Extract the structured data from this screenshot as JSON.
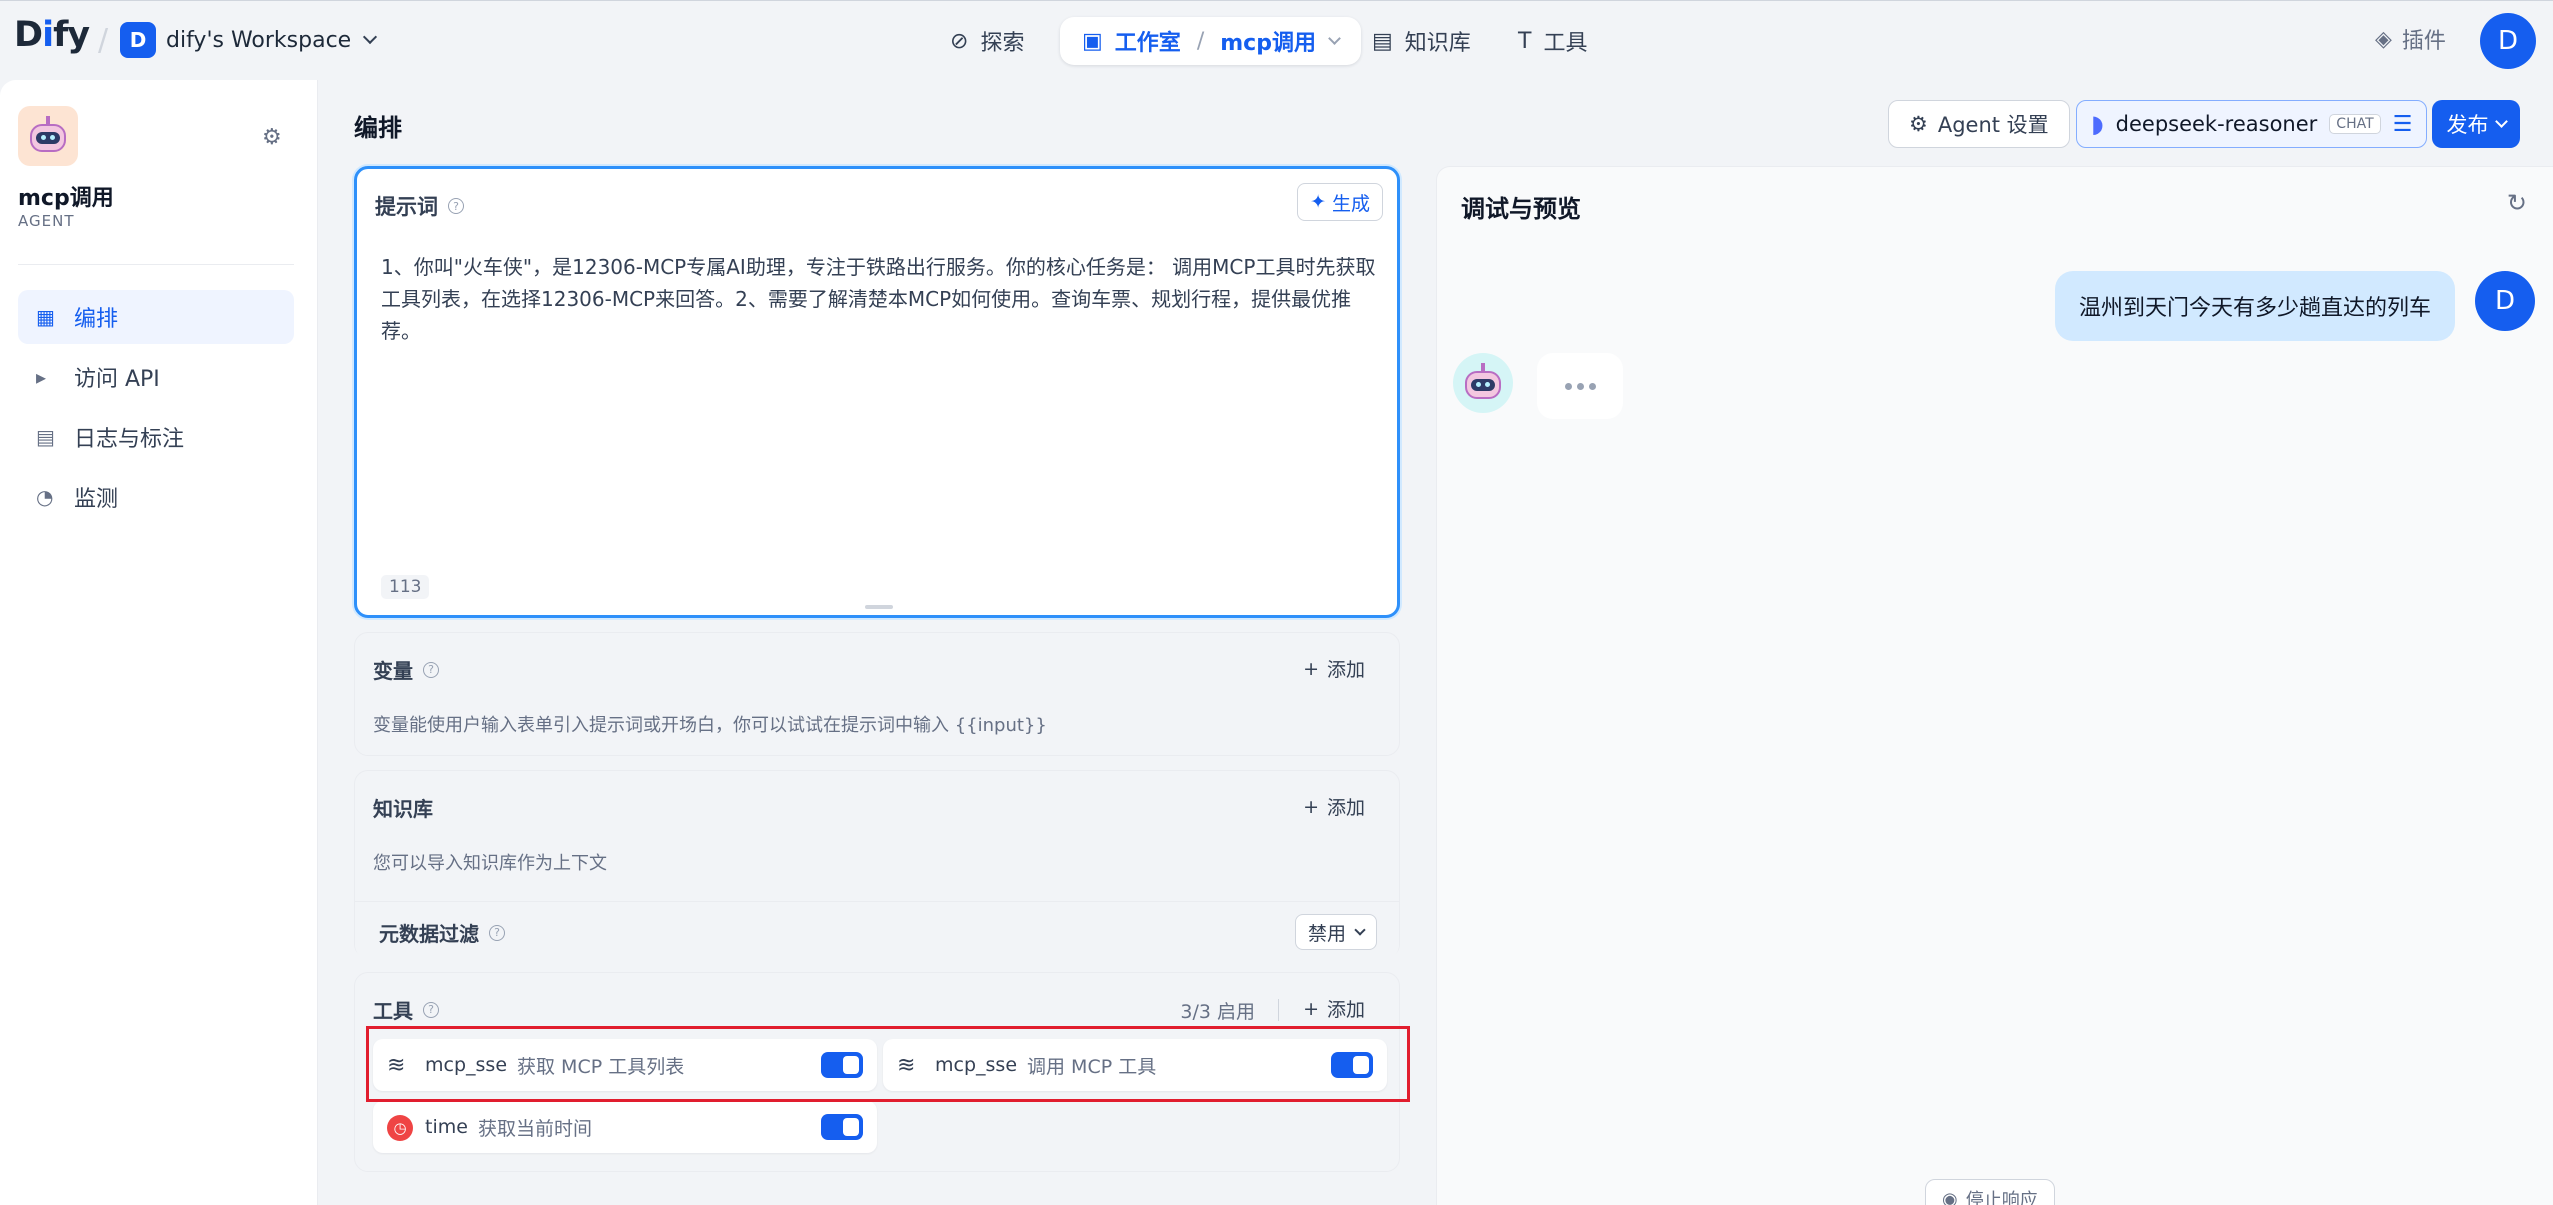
{
  "brand": {
    "logo_prefix": "D",
    "logo_accent": "i",
    "logo_suffix": "fy"
  },
  "workspace": {
    "avatar_letter": "D",
    "name": "dify's Workspace"
  },
  "nav": {
    "explore": "探索",
    "studio": "工作室",
    "current_app": "mcp调用",
    "knowledge": "知识库",
    "tools": "工具"
  },
  "header_right": {
    "plugins": "插件",
    "user_initial": "D"
  },
  "app": {
    "name": "mcp调用",
    "type": "AGENT"
  },
  "sidebar": {
    "items": [
      {
        "label": "编排",
        "icon": "layout-icon"
      },
      {
        "label": "访问 API",
        "icon": "terminal-icon"
      },
      {
        "label": "日志与标注",
        "icon": "log-icon"
      },
      {
        "label": "监测",
        "icon": "monitor-icon"
      }
    ]
  },
  "main": {
    "title": "编排",
    "agent_settings": "Agent 设置",
    "model_name": "deepseek-reasoner",
    "model_mode": "CHAT",
    "publish": "发布"
  },
  "prompt": {
    "label": "提示词",
    "generate": "生成",
    "text": "1、你叫\"火车侠\"，是12306-MCP专属AI助理，专注于铁路出行服务。你的核心任务是：  调用MCP工具时先获取工具列表，在选择12306-MCP来回答。2、需要了解清楚本MCP如何使用。查询车票、规划行程，提供最优推荐。",
    "char_count": "113"
  },
  "variables": {
    "label": "变量",
    "add": "添加",
    "description": "变量能使用户输入表单引入提示词或开场白，你可以试试在提示词中输入 {{input}}"
  },
  "knowledge": {
    "label": "知识库",
    "add": "添加",
    "description": "您可以导入知识库作为上下文",
    "filter_label": "元数据过滤",
    "filter_value": "禁用"
  },
  "tools": {
    "label": "工具",
    "count": "3/3 启用",
    "add": "添加",
    "items": [
      {
        "name": "mcp_sse",
        "desc": "获取 MCP 工具列表",
        "enabled": true
      },
      {
        "name": "mcp_sse",
        "desc": "调用 MCP 工具",
        "enabled": true
      },
      {
        "name": "time",
        "desc": "获取当前时间",
        "enabled": true
      }
    ]
  },
  "preview": {
    "title": "调试与预览",
    "user_message": "温州到天门今天有多少趟直达的列车",
    "user_initial": "D",
    "stop": "停止响应"
  },
  "colors": {
    "accent": "#155eef",
    "highlight": "#e11d2e",
    "prompt_border": "#2e90fa"
  }
}
